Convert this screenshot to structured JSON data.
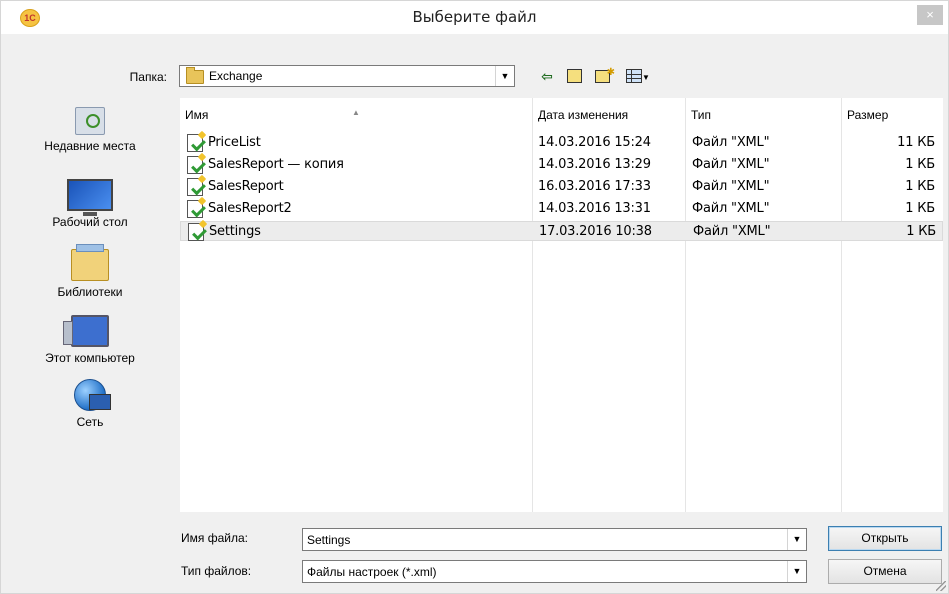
{
  "window": {
    "title": "Выберите файл",
    "close_glyph": "×",
    "app_icon_text": "1С"
  },
  "toolbar": {
    "folder_label": "Папка:",
    "folder_value": "Exchange",
    "back_glyph": "⇦",
    "up_icon": "folder-up-icon",
    "new_folder_icon": "new-folder-icon",
    "view_menu_icon": "view-menu-icon"
  },
  "places": [
    {
      "label": "Недавние места",
      "icon": "recent-places-icon"
    },
    {
      "label": "Рабочий стол",
      "icon": "desktop-icon"
    },
    {
      "label": "Библиотеки",
      "icon": "libraries-icon"
    },
    {
      "label": "Этот компьютер",
      "icon": "computer-icon"
    },
    {
      "label": "Сеть",
      "icon": "network-icon"
    }
  ],
  "list": {
    "columns": [
      "Имя",
      "Дата изменения",
      "Тип",
      "Размер"
    ],
    "sort_indicator": "^",
    "rows": [
      {
        "name": "PriceList",
        "date": "14.03.2016 15:24",
        "type": "Файл \"XML\"",
        "size": "11 КБ",
        "selected": false
      },
      {
        "name": "SalesReport — копия",
        "date": "14.03.2016 13:29",
        "type": "Файл \"XML\"",
        "size": "1 КБ",
        "selected": false
      },
      {
        "name": "SalesReport",
        "date": "16.03.2016 17:33",
        "type": "Файл \"XML\"",
        "size": "1 КБ",
        "selected": false
      },
      {
        "name": "SalesReport2",
        "date": "14.03.2016 13:31",
        "type": "Файл \"XML\"",
        "size": "1 КБ",
        "selected": false
      },
      {
        "name": "Settings",
        "date": "17.03.2016 10:38",
        "type": "Файл \"XML\"",
        "size": "1 КБ",
        "selected": true
      }
    ]
  },
  "footer": {
    "filename_label": "Имя файла:",
    "filename_value": "Settings",
    "filetype_label": "Тип файлов:",
    "filetype_value": "Файлы настроек (*.xml)",
    "open_button": "Открыть",
    "cancel_button": "Отмена"
  }
}
